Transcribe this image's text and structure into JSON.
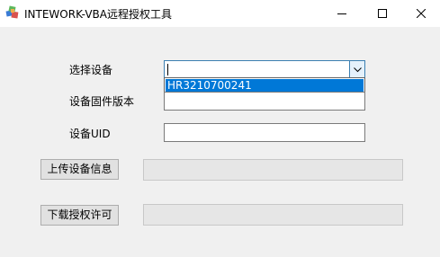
{
  "window": {
    "title": "INTEWORK-VBA远程授权工具",
    "icons": {
      "app": "app-icon",
      "minimize": "minimize-icon",
      "maximize": "maximize-icon",
      "close": "close-icon"
    }
  },
  "form": {
    "device_select": {
      "label": "选择设备",
      "value": "",
      "options": [
        "HR3210700241"
      ],
      "highlighted_option": "HR3210700241"
    },
    "firmware_version": {
      "label": "设备固件版本",
      "value": ""
    },
    "device_uid": {
      "label": "设备UID",
      "value": ""
    }
  },
  "actions": {
    "upload_button": "上传设备信息",
    "upload_status": "",
    "download_button": "下载授权许可",
    "download_status": ""
  },
  "colors": {
    "window_bg": "#f0f0f0",
    "titlebar_bg": "#ffffff",
    "focus_border": "#3c7fb1",
    "selection_bg": "#0078d7"
  }
}
